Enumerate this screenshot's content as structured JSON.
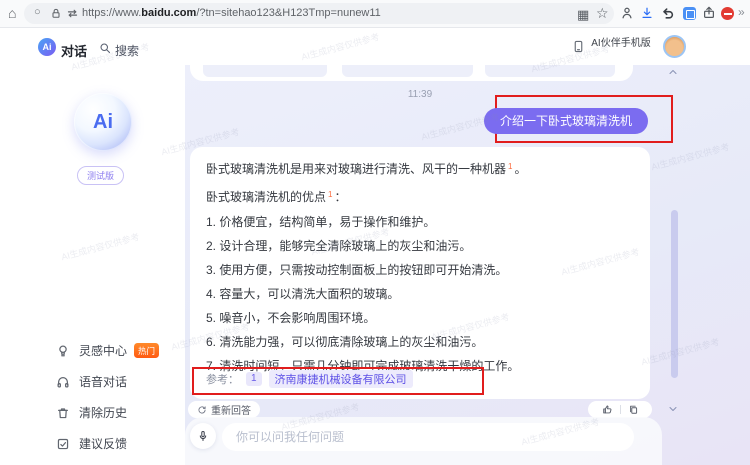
{
  "browser": {
    "url_prefix": "https://www.",
    "url_domain": "baidu.com",
    "url_suffix": "/?tn=sitehao123&H123Tmp=nunew11",
    "home_glyph": "⌂",
    "site_glyph": "○",
    "qr_glyph": "▦",
    "star_glyph": "☆",
    "more_glyph": "»"
  },
  "header": {
    "logo_text": "Ai",
    "chat_tab": "对话",
    "search_tab": "搜索",
    "mobile_companion": "AI伙伴手机版"
  },
  "sidebar": {
    "logo_text": "Ai",
    "beta_badge": "测试版",
    "menu": [
      {
        "label": "灵感中心",
        "icon": "lightbulb-icon",
        "badge": "热门"
      },
      {
        "label": "语音对话",
        "icon": "headphones-icon"
      },
      {
        "label": "清除历史",
        "icon": "trash-icon"
      },
      {
        "label": "建议反馈",
        "icon": "feedback-icon"
      }
    ]
  },
  "chat": {
    "timestamp": "11:39",
    "user_message": "介绍一下卧式玻璃清洗机",
    "answer": {
      "intro_text": "卧式玻璃清洗机是用来对玻璃进行清洗、风干的一种机器",
      "intro_ref": "1",
      "intro_tail": "。",
      "subtitle_text": "卧式玻璃清洗机的优点",
      "subtitle_ref": "1",
      "subtitle_tail": "：",
      "points": [
        "1. 价格便宜，结构简单，易于操作和维护。",
        "2. 设计合理，能够完全清除玻璃上的灰尘和油污。",
        "3. 使用方便，只需按动控制面板上的按钮即可开始清洗。",
        "4. 容量大，可以清洗大面积的玻璃。",
        "5. 噪音小，不会影响周围环境。",
        "6. 清洗能力强，可以彻底清除玻璃上的灰尘和油污。",
        "7. 清洗时间短，只需几分钟即可完成玻璃清洗干燥的工作。"
      ],
      "reference_label": "参考：",
      "reference_index": "1",
      "reference_link": "济南康捷机械设备有限公司"
    },
    "regenerate_label": "重新回答",
    "input_placeholder": "你可以问我任何问题"
  },
  "watermark": {
    "text": "AI生成内容仅供参考"
  },
  "colors": {
    "accent_purple": "#7b6cf0",
    "annotation_red": "#e11d1d",
    "hot_badge_orange": "#ff6600",
    "reference_link_purple": "#5d50e6",
    "download_blue": "#2a6df5"
  }
}
